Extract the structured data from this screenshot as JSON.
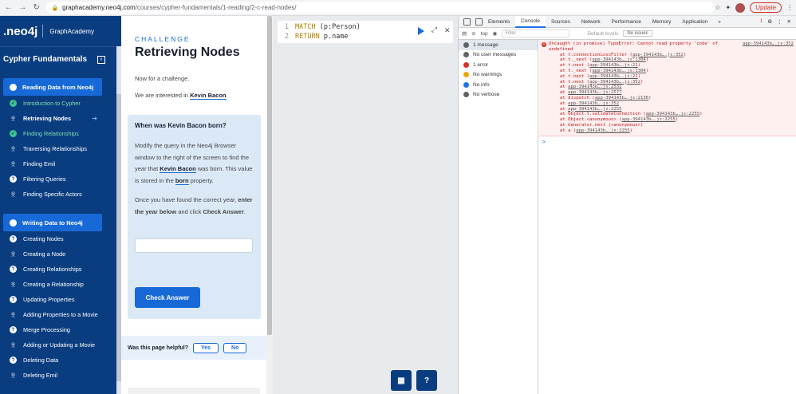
{
  "browser": {
    "url_host": "graphacademy.neo4j.com",
    "url_path": "/courses/cypher-fundamentals/1-reading/2-c-read-nodes/",
    "update_label": "Update"
  },
  "sidebar": {
    "logo": ".neo4j",
    "brand_label": "GraphAcademy",
    "course_title": "Cypher Fundamentals",
    "sections": [
      {
        "title": "Reading Data from Neo4j",
        "items": [
          {
            "label": "Introduction to Cypher",
            "state": "done",
            "icon": "check"
          },
          {
            "label": "Retrieving Nodes",
            "state": "current",
            "icon": "person"
          },
          {
            "label": "Finding Relationships",
            "state": "done",
            "icon": "check"
          },
          {
            "label": "Traversing Relationships",
            "state": "",
            "icon": "person"
          },
          {
            "label": "Finding Emil",
            "state": "",
            "icon": "person"
          },
          {
            "label": "Filtering Queries",
            "state": "",
            "icon": "question"
          },
          {
            "label": "Finding Specific Actors",
            "state": "",
            "icon": "person"
          }
        ]
      },
      {
        "title": "Writing Data to Neo4j",
        "items": [
          {
            "label": "Creating Nodes",
            "state": "",
            "icon": "question"
          },
          {
            "label": "Creating a Node",
            "state": "",
            "icon": "person"
          },
          {
            "label": "Creating Relationships",
            "state": "",
            "icon": "question"
          },
          {
            "label": "Creating a Relationship",
            "state": "",
            "icon": "person"
          },
          {
            "label": "Updating Properties",
            "state": "",
            "icon": "question"
          },
          {
            "label": "Adding Properties to a Movie",
            "state": "",
            "icon": "person"
          },
          {
            "label": "Merge Processing",
            "state": "",
            "icon": "question"
          },
          {
            "label": "Adding or Updating a Movie",
            "state": "",
            "icon": "person"
          },
          {
            "label": "Deleting Data",
            "state": "",
            "icon": "question"
          },
          {
            "label": "Deleting Emil",
            "state": "",
            "icon": "person"
          }
        ]
      }
    ]
  },
  "lesson": {
    "eyebrow": "CHALLENGE",
    "title": "Retrieving Nodes",
    "intro": "Now for a challenge.",
    "interest_prefix": "We are interested in",
    "interest_name": "Kevin Bacon",
    "interest_suffix": ".",
    "question_title": "When was Kevin Bacon born?",
    "q_p1_a": "Modify the query in the Neo4j Browser window to the right of the screen to find the year that",
    "q_p1_name": "Kevin Bacon",
    "q_p1_b": "was born. This value is stored in the",
    "q_p1_prop": "born",
    "q_p1_c": "property.",
    "q_p2_a": "Once you have found the correct year,",
    "q_p2_bold": "enter the year below",
    "q_p2_b": "and click",
    "q_p2_bold2": "Check Answer",
    "q_p2_c": ".",
    "answer_value": "",
    "check_label": "Check Answer",
    "helpful_label": "Was this page helpful?",
    "yes_label": "Yes",
    "no_label": "No"
  },
  "editor": {
    "line1_no": "1",
    "line1_kw": "MATCH",
    "line1_code": "(p:Person)",
    "line2_no": "2",
    "line2_kw": "RETURN",
    "line2_code": "p.name"
  },
  "devtools": {
    "tabs": [
      "Elements",
      "Console",
      "Sources",
      "Network",
      "Performance",
      "Memory",
      "Application"
    ],
    "active_tab": "Console",
    "error_count": "1",
    "context": "top",
    "filter_placeholder": "Filter",
    "levels": "Default levels",
    "issues": "No issues",
    "side": [
      {
        "label": "1 message",
        "color": "#5f6368"
      },
      {
        "label": "No user messages",
        "color": "#5f6368"
      },
      {
        "label": "1 error",
        "color": "#d93025"
      },
      {
        "label": "No warnings",
        "color": "#f2a600"
      },
      {
        "label": "No info",
        "color": "#1a73e8"
      },
      {
        "label": "No verbose",
        "color": "#5f6368"
      }
    ],
    "error_head": "Uncaught (in promise) TypeError: Cannot read property 'code' of",
    "error_head2": "undefined",
    "error_src": "app-394143b….js:352",
    "stack": [
      [
        "at t.connectionLossFilter (",
        "app-394143b….js:352",
        ")"
      ],
      [
        "at t._next (",
        "app-394143b….js:1304",
        ")"
      ],
      [
        "at t.next (",
        "app-394143b….js:21",
        ")"
      ],
      [
        "at t._next (",
        "app-394143b….js:1304",
        ")"
      ],
      [
        "at t.next (",
        "app-394143b….js:21",
        ")"
      ],
      [
        "at t.next (",
        "app-394143b….js:352",
        ")"
      ],
      [
        "at ",
        "app-394143b….js:2531",
        ""
      ],
      [
        "at ",
        "app-394143b….js:2577",
        ""
      ],
      [
        "at dispatch (",
        "app-394143b….js:2136",
        ")"
      ],
      [
        "at ",
        "app-394143b….js:352",
        ""
      ],
      [
        "at ",
        "app-394143b….js:2255",
        ""
      ],
      [
        "at Object.t.validateConnection (",
        "app-394143b….js:2255",
        ")"
      ],
      [
        "at Object.<anonymous> (",
        "app-394143b….js:2255",
        ")"
      ],
      [
        "at Generator.next (<anonymous>)",
        "",
        ""
      ],
      [
        "at a (",
        "app-394143b….js:2255",
        ")"
      ]
    ],
    "prompt": ">"
  }
}
